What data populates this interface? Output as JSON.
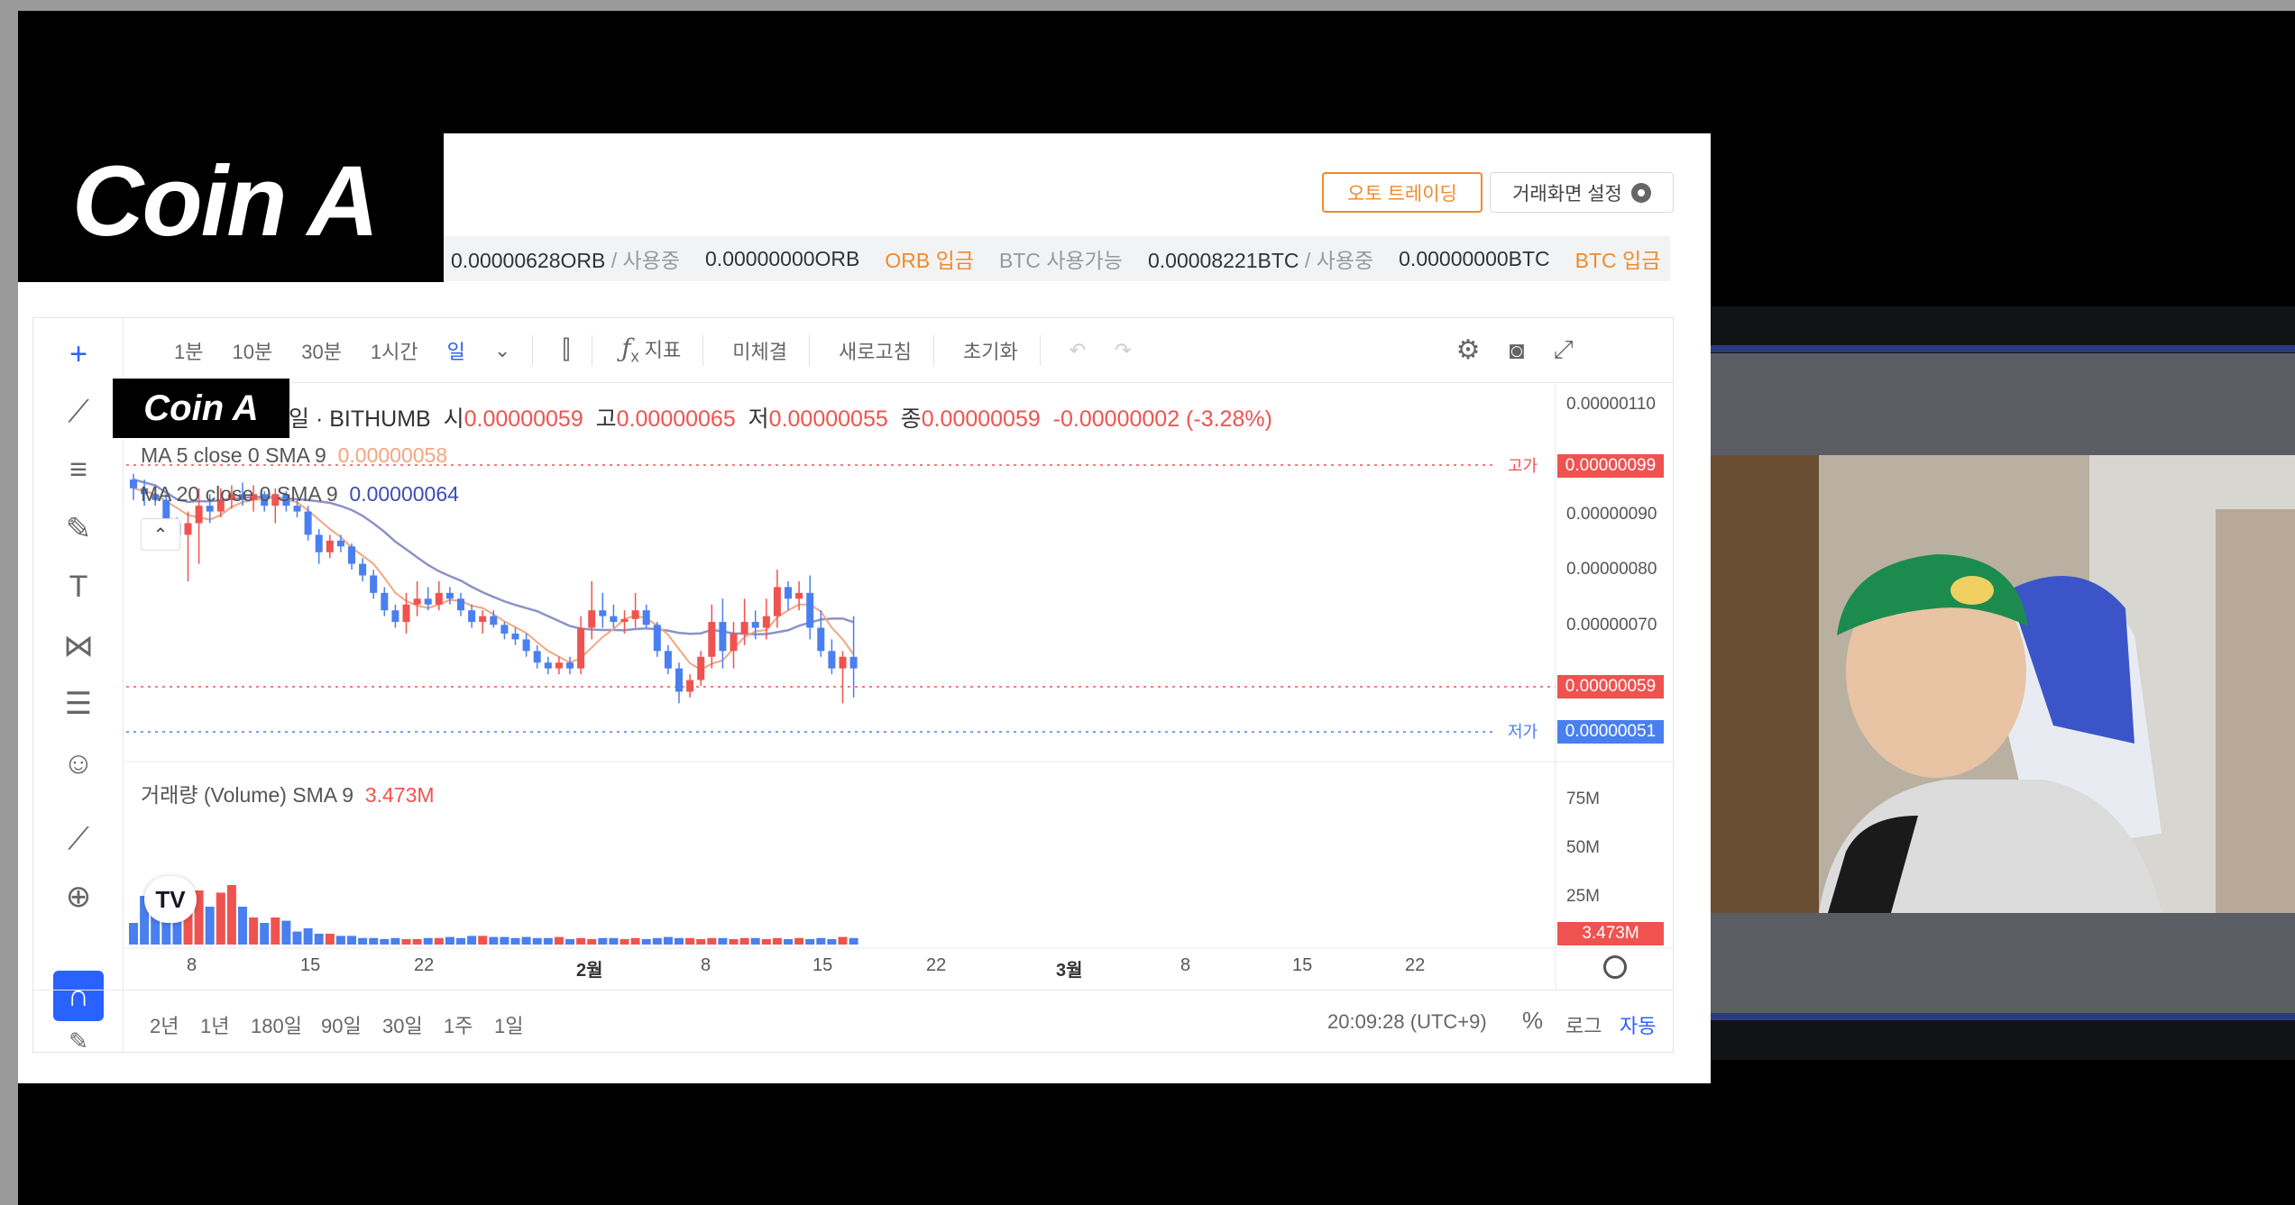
{
  "overlay_title": "Coin A",
  "header": {
    "auto_trading_label": "오토 트레이딩",
    "screen_settings_label": "거래화면 설정"
  },
  "balance": {
    "orb_available": "0.00000628ORB",
    "orb_in_use_label": "/ 사용중",
    "orb_in_use": "0.00000000ORB",
    "orb_deposit": "ORB 입금",
    "btc_available_label": "BTC 사용가능",
    "btc_available": "0.00008221BTC",
    "btc_in_use_label": "/ 사용중",
    "btc_in_use": "0.00000000BTC",
    "btc_deposit": "BTC 입금"
  },
  "toolbar": {
    "intervals": [
      "1분",
      "10분",
      "30분",
      "1시간",
      "일"
    ],
    "active_interval": "일",
    "indicator_label": "지표",
    "unfilled_label": "미체결",
    "refresh_label": "새로고침",
    "reset_label": "초기화"
  },
  "legend": {
    "title_suffix": "일 · BITHUMB",
    "open_label": "시",
    "open": "0.00000059",
    "high_label": "고",
    "high": "0.00000065",
    "low_label": "저",
    "low": "0.00000055",
    "close_label": "종",
    "close": "0.00000059",
    "change": "-0.00000002 (-3.28%)",
    "ma5_label": "MA 5 close 0 SMA 9",
    "ma5_value": "0.00000058",
    "ma20_label": "MA 20 close 0 SMA 9",
    "ma20_value": "0.00000064",
    "volume_label": "거래량 (Volume) SMA 9",
    "volume_value": "3.473M"
  },
  "price_axis": {
    "ticks": [
      "0.00000110",
      "0.00000090",
      "0.00000080",
      "0.00000070"
    ],
    "high_tag_label": "고가",
    "high_tag": "0.00000099",
    "last_tag": "0.00000059",
    "low_tag_label": "저가",
    "low_tag": "0.00000051"
  },
  "volume_axis": {
    "ticks": [
      "75M",
      "50M",
      "25M"
    ],
    "last_tag": "3.473M"
  },
  "time_axis": {
    "labels": [
      "8",
      "15",
      "22",
      "2월",
      "8",
      "15",
      "22",
      "3월",
      "8",
      "15",
      "22"
    ]
  },
  "bottom_bar": {
    "ranges": [
      "2년",
      "1년",
      "180일",
      "90일",
      "30일",
      "1주",
      "1일"
    ],
    "clock": "20:09:28 (UTC+9)",
    "percent_label": "%",
    "log_label": "로그",
    "auto_label": "자동"
  },
  "colors": {
    "up": "#ef5350",
    "down": "#4a7ff0",
    "ma5": "#f4a582",
    "ma20": "#8c92c8",
    "accent": "#2962ff",
    "orange": "#f08a2c"
  },
  "chart_data": {
    "type": "candlestick",
    "ohlc_normalized": [
      [
        0.95,
        0.97,
        0.88,
        0.92
      ],
      [
        0.92,
        0.95,
        0.86,
        0.9
      ],
      [
        0.9,
        0.93,
        0.86,
        0.88
      ],
      [
        0.88,
        0.9,
        0.78,
        0.8
      ],
      [
        0.8,
        0.82,
        0.72,
        0.76
      ],
      [
        0.76,
        0.84,
        0.6,
        0.8
      ],
      [
        0.8,
        0.92,
        0.66,
        0.86
      ],
      [
        0.86,
        0.9,
        0.8,
        0.84
      ],
      [
        0.84,
        0.92,
        0.82,
        0.88
      ],
      [
        0.88,
        0.93,
        0.85,
        0.9
      ],
      [
        0.9,
        0.94,
        0.86,
        0.88
      ],
      [
        0.88,
        0.93,
        0.84,
        0.9
      ],
      [
        0.9,
        0.91,
        0.84,
        0.86
      ],
      [
        0.86,
        0.92,
        0.8,
        0.9
      ],
      [
        0.9,
        0.91,
        0.84,
        0.86
      ],
      [
        0.86,
        0.88,
        0.82,
        0.84
      ],
      [
        0.84,
        0.86,
        0.74,
        0.76
      ],
      [
        0.76,
        0.78,
        0.66,
        0.7
      ],
      [
        0.7,
        0.76,
        0.68,
        0.74
      ],
      [
        0.74,
        0.76,
        0.7,
        0.72
      ],
      [
        0.72,
        0.73,
        0.64,
        0.66
      ],
      [
        0.66,
        0.68,
        0.6,
        0.62
      ],
      [
        0.62,
        0.64,
        0.54,
        0.56
      ],
      [
        0.56,
        0.58,
        0.48,
        0.5
      ],
      [
        0.5,
        0.52,
        0.44,
        0.46
      ],
      [
        0.46,
        0.56,
        0.42,
        0.52
      ],
      [
        0.52,
        0.6,
        0.48,
        0.54
      ],
      [
        0.54,
        0.58,
        0.5,
        0.52
      ],
      [
        0.52,
        0.6,
        0.5,
        0.56
      ],
      [
        0.56,
        0.58,
        0.52,
        0.54
      ],
      [
        0.54,
        0.56,
        0.48,
        0.5
      ],
      [
        0.5,
        0.52,
        0.44,
        0.46
      ],
      [
        0.46,
        0.5,
        0.42,
        0.48
      ],
      [
        0.48,
        0.5,
        0.44,
        0.45
      ],
      [
        0.45,
        0.46,
        0.4,
        0.42
      ],
      [
        0.42,
        0.44,
        0.38,
        0.4
      ],
      [
        0.4,
        0.42,
        0.34,
        0.36
      ],
      [
        0.36,
        0.38,
        0.3,
        0.32
      ],
      [
        0.32,
        0.34,
        0.28,
        0.3
      ],
      [
        0.3,
        0.34,
        0.28,
        0.32
      ],
      [
        0.32,
        0.34,
        0.28,
        0.3
      ],
      [
        0.3,
        0.48,
        0.28,
        0.44
      ],
      [
        0.44,
        0.6,
        0.4,
        0.5
      ],
      [
        0.5,
        0.56,
        0.44,
        0.48
      ],
      [
        0.48,
        0.52,
        0.44,
        0.46
      ],
      [
        0.46,
        0.5,
        0.42,
        0.47
      ],
      [
        0.47,
        0.56,
        0.44,
        0.5
      ],
      [
        0.5,
        0.52,
        0.44,
        0.45
      ],
      [
        0.45,
        0.46,
        0.34,
        0.36
      ],
      [
        0.36,
        0.38,
        0.28,
        0.3
      ],
      [
        0.3,
        0.32,
        0.18,
        0.22
      ],
      [
        0.22,
        0.28,
        0.2,
        0.26
      ],
      [
        0.26,
        0.36,
        0.24,
        0.34
      ],
      [
        0.34,
        0.52,
        0.3,
        0.46
      ],
      [
        0.46,
        0.54,
        0.3,
        0.36
      ],
      [
        0.36,
        0.46,
        0.3,
        0.42
      ],
      [
        0.42,
        0.54,
        0.38,
        0.46
      ],
      [
        0.46,
        0.5,
        0.4,
        0.44
      ],
      [
        0.44,
        0.54,
        0.4,
        0.48
      ],
      [
        0.48,
        0.64,
        0.44,
        0.58
      ],
      [
        0.58,
        0.6,
        0.5,
        0.54
      ],
      [
        0.54,
        0.6,
        0.5,
        0.56
      ],
      [
        0.56,
        0.62,
        0.4,
        0.44
      ],
      [
        0.44,
        0.5,
        0.34,
        0.36
      ],
      [
        0.36,
        0.4,
        0.28,
        0.3
      ],
      [
        0.3,
        0.36,
        0.18,
        0.34
      ],
      [
        0.34,
        0.48,
        0.2,
        0.3
      ]
    ],
    "volume_normalized": [
      0.2,
      0.45,
      0.55,
      0.5,
      0.45,
      0.48,
      0.5,
      0.35,
      0.48,
      0.55,
      0.35,
      0.25,
      0.2,
      0.25,
      0.22,
      0.12,
      0.15,
      0.1,
      0.1,
      0.08,
      0.08,
      0.06,
      0.06,
      0.05,
      0.06,
      0.05,
      0.05,
      0.06,
      0.06,
      0.07,
      0.06,
      0.08,
      0.08,
      0.07,
      0.07,
      0.06,
      0.07,
      0.06,
      0.06,
      0.07,
      0.05,
      0.06,
      0.05,
      0.06,
      0.06,
      0.05,
      0.06,
      0.05,
      0.06,
      0.07,
      0.06,
      0.06,
      0.05,
      0.06,
      0.06,
      0.05,
      0.06,
      0.06,
      0.05,
      0.06,
      0.05,
      0.06,
      0.05,
      0.06,
      0.05,
      0.07,
      0.06
    ]
  }
}
